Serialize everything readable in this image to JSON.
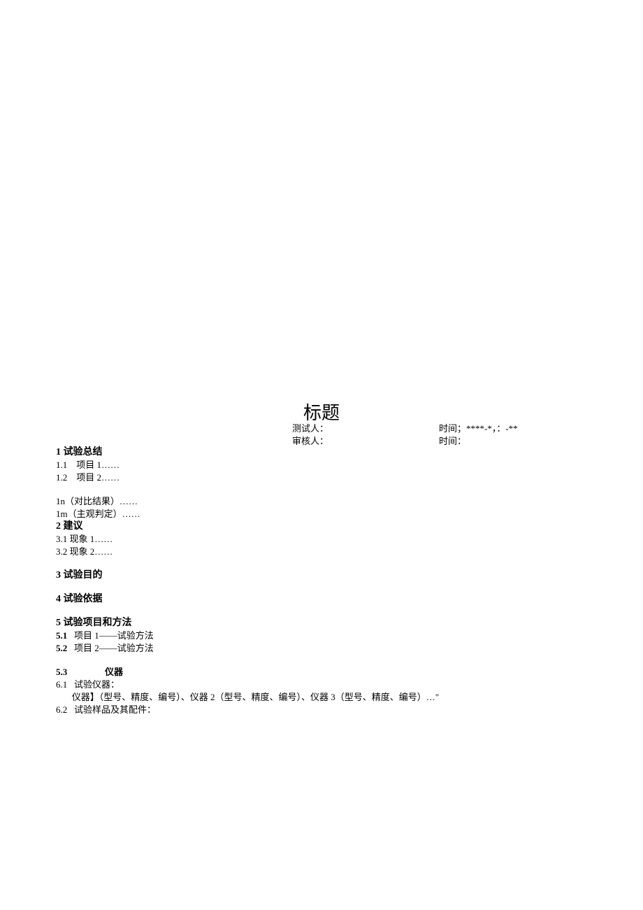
{
  "title": "标题",
  "meta": {
    "tester_label": "测试人：",
    "tester_time": "时间；****-*，：-**",
    "reviewer_label": "审核人：",
    "reviewer_time": "时间："
  },
  "sec1": {
    "heading": "1 试验总结",
    "item1": "1.1    项目 1……",
    "item2": "1.2    项目 2……",
    "itemn": "1n（对比结果）……",
    "itemm": "1m（主观判定）……"
  },
  "sec2": {
    "heading": "2 建议",
    "item1": "3.1 现象 1……",
    "item2": "3.2 现象 2……"
  },
  "sec3": {
    "heading": "3 试验目的"
  },
  "sec4": {
    "heading": "4 试验依据"
  },
  "sec5": {
    "heading": "5 试验项目和方法",
    "p1_num": "5.1",
    "p1_text": "   项目 1——试验方法",
    "p2_num": "5.2",
    "p2_text": "   项目 2——试验方法",
    "p3_num": "5.3",
    "p3_text": "仪器"
  },
  "sec6": {
    "item1_num": "6.1",
    "item1_text": "   试验仪器：",
    "item1_body": "       仪器】（型号、精度、编号）、仪器 2（型号、精度、编号）、仪器 3（型号、精度、编号）…\"",
    "item2_num": "6.2",
    "item2_text": "   试验样品及其配件："
  }
}
